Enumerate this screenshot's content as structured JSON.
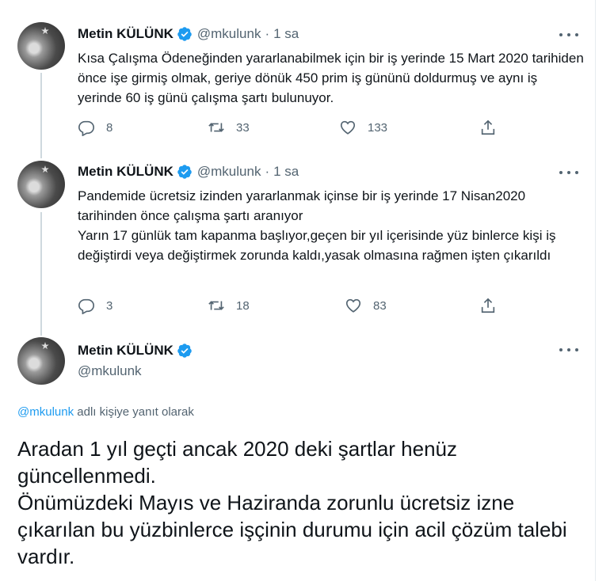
{
  "tweets": [
    {
      "name": "Metin KÜLÜNK",
      "handle": "@mkulunk",
      "dot": "·",
      "time": "1 sa",
      "text": "Kısa Çalışma Ödeneğinden yararlanabilmek için bir  iş yerinde 15 Mart 2020 tarihiden  önce işe girmiş olmak, geriye dönük 450 prim iş gününü doldurmuş ve aynı iş yerinde 60 iş günü çalışma şartı bulunuyor.",
      "replies": "8",
      "retweets": "33",
      "likes": "133"
    },
    {
      "name": "Metin KÜLÜNK",
      "handle": "@mkulunk",
      "dot": "·",
      "time": "1 sa",
      "text_line1": "Pandemide ücretsiz izinden yararlanmak içinse bir iş yerinde 17 Nisan2020 tarihinden önce çalışma şartı aranıyor",
      "text_line2": "Yarın 17 günlük tam kapanma başlıyor,geçen bir yıl içerisinde yüz binlerce kişi iş değiştirdi veya değiştirmek zorunda kaldı,yasak olmasına rağmen işten çıkarıldı",
      "replies": "3",
      "retweets": "18",
      "likes": "83"
    }
  ],
  "main_tweet": {
    "name": "Metin KÜLÜNK",
    "handle": "@mkulunk",
    "reply_mention": "@mkulunk",
    "reply_suffix": " adlı kişiye yanıt olarak",
    "text_line1": "Aradan 1 yıl geçti ancak 2020 deki şartlar henüz güncellenmedi.",
    "text_line2": "Önümüzdeki Mayıs ve Haziranda zorunlu ücretsiz izne çıkarılan bu yüzbinlerce işçinin durumu için acil çözüm talebi vardır."
  },
  "colors": {
    "verified": "#1d9bf0",
    "secondary_text": "#536471",
    "link": "#1d9bf0"
  },
  "icons": [
    "reply-icon",
    "retweet-icon",
    "like-icon",
    "share-icon",
    "more-icon",
    "verified-badge-icon"
  ]
}
